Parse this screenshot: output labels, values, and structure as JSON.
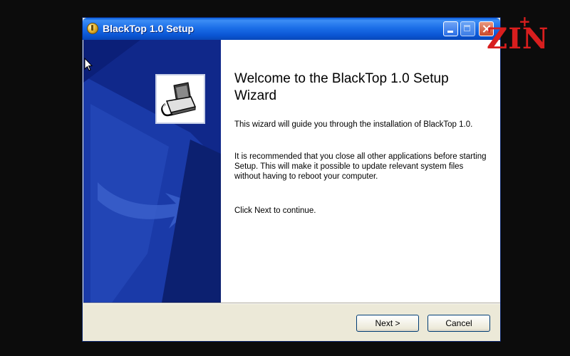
{
  "window": {
    "title": "BlackTop 1.0 Setup",
    "title_icon": "installer-disc-icon"
  },
  "titlebar_buttons": {
    "minimize": "minimize-icon",
    "maximize": "maximize-icon",
    "close": "close-icon"
  },
  "wizard": {
    "heading": "Welcome to the BlackTop 1.0 Setup Wizard",
    "paragraph_1": "This wizard will guide you through the installation of BlackTop 1.0.",
    "paragraph_2": "It is recommended that you close all other applications before starting Setup. This will make it possible to update relevant system files without having to reboot your computer.",
    "paragraph_3": "Click Next to continue."
  },
  "buttons": {
    "next": "Next >",
    "cancel": "Cancel"
  },
  "watermark": {
    "text": "ZIN"
  },
  "colors": {
    "titlebar": "#1c6fe8",
    "side_panel": "#10288a",
    "watermark": "#d81e1e"
  }
}
